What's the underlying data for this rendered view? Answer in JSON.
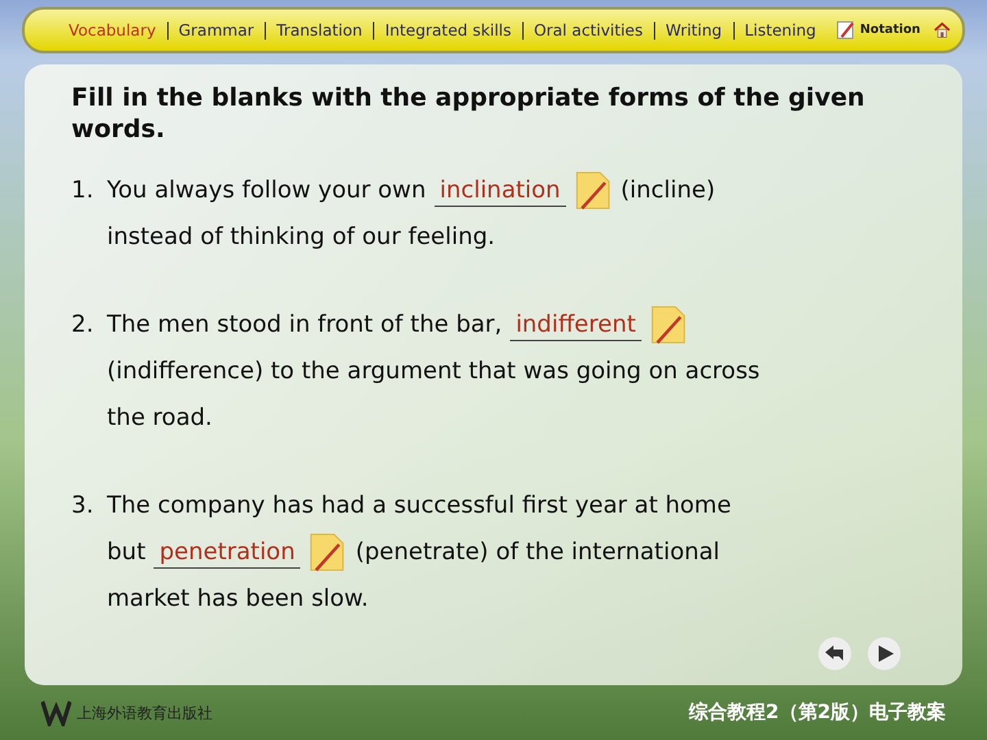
{
  "nav": {
    "items": [
      {
        "label": "Vocabulary",
        "selected": true
      },
      {
        "label": "Grammar",
        "selected": false
      },
      {
        "label": "Translation",
        "selected": false
      },
      {
        "label": "Integrated skills",
        "selected": false
      },
      {
        "label": "Oral activities",
        "selected": false
      },
      {
        "label": "Writing",
        "selected": false
      },
      {
        "label": "Listening",
        "selected": false
      }
    ],
    "notation": "Notation"
  },
  "instruction": "Fill in the blanks with the appropriate forms of the given words.",
  "questions": [
    {
      "number": "1.",
      "lines": [
        [
          {
            "kind": "text",
            "text": "You always follow your own"
          },
          {
            "kind": "answer",
            "text": "inclination"
          },
          {
            "kind": "text",
            "text": "(incline)"
          }
        ],
        [
          {
            "kind": "text",
            "text": "instead of thinking of our feeling."
          }
        ]
      ]
    },
    {
      "number": "2.",
      "lines": [
        [
          {
            "kind": "text",
            "text": "The men stood in front of the bar,"
          },
          {
            "kind": "answer",
            "text": "indifferent"
          }
        ],
        [
          {
            "kind": "text",
            "text": "(indifference) to the argument that was going on across"
          }
        ],
        [
          {
            "kind": "text",
            "text": "the road."
          }
        ]
      ]
    },
    {
      "number": "3.",
      "lines": [
        [
          {
            "kind": "text",
            "text": "The company has had a successful first year at home"
          }
        ],
        [
          {
            "kind": "text",
            "text": "but"
          },
          {
            "kind": "answer",
            "text": "penetration"
          },
          {
            "kind": "text",
            "text": "(penetrate) of the international"
          }
        ],
        [
          {
            "kind": "text",
            "text": "market has been slow."
          }
        ]
      ]
    }
  ],
  "footer": {
    "publisher": "上海外语教育出版社",
    "course": "综合教程2（第2版）电子教案"
  }
}
